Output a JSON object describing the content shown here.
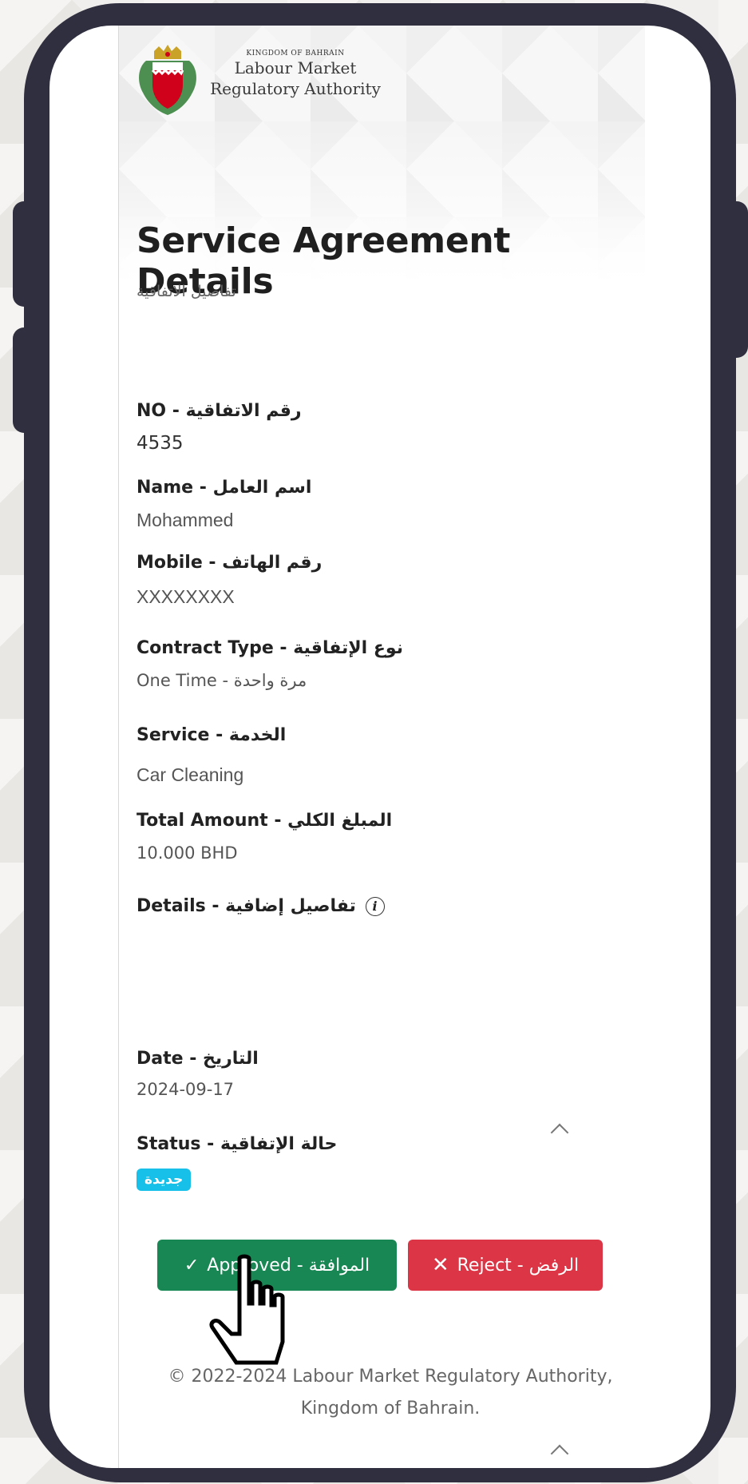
{
  "logo": {
    "line1": "KINGDOM OF BAHRAIN",
    "line2": "Labour Market",
    "line3": "Regulatory Authority"
  },
  "page": {
    "title": "Service Agreement Details",
    "subtitle": "تفاصيل الاتفاقية"
  },
  "fields": {
    "no_label": "NO - رقم الاتفاقية",
    "no_value": "4535",
    "name_label": "Name - اسم العامل",
    "name_value": "Mohammed",
    "mobile_label": "Mobile - رقم الهاتف",
    "mobile_value": "XXXXXXXX",
    "contract_label": "Contract Type - نوع الإتفاقية",
    "contract_value": "One Time - مرة واحدة",
    "service_label": "Service - الخدمة",
    "service_value": "Car Cleaning",
    "amount_label": "Total Amount - المبلغ الكلي",
    "amount_value": "10.000 BHD",
    "details_label": "Details - تفاصيل إضافية",
    "date_label": "Date - التاريخ",
    "date_value": "2024-09-17",
    "status_label": "Status - حالة الإتفاقية",
    "status_value": "جديدة"
  },
  "actions": {
    "approve_label": "Approved - الموافقة",
    "reject_label": "Reject - الرفض"
  },
  "footer": {
    "line1": "© 2022-2024 Labour Market Regulatory Authority,",
    "line2": "Kingdom of Bahrain."
  },
  "colors": {
    "approve": "#198754",
    "reject": "#dc3545",
    "badge": "#16c0e8",
    "phone_frame": "#2f2f3f"
  },
  "icons": {
    "approve": "check-icon",
    "reject": "x-icon",
    "details": "info-icon",
    "collapse": "chevron-up-icon",
    "pointer": "hand-pointer-icon"
  }
}
